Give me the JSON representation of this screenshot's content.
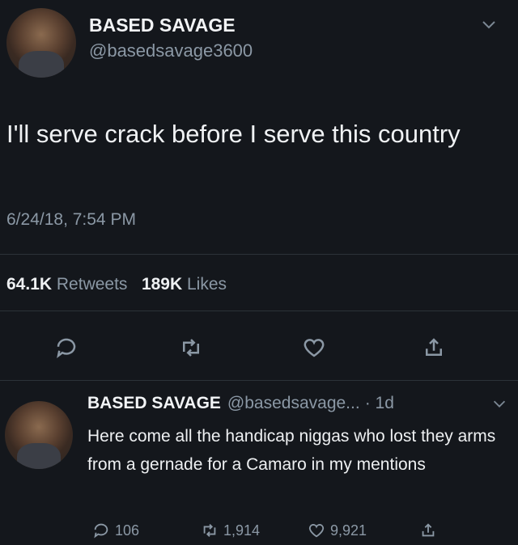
{
  "tweet": {
    "display_name": "BASED SAVAGE",
    "handle": "@basedsavage3600",
    "text": "I'll serve crack before I serve this country",
    "timestamp": "6/24/18, 7:54 PM",
    "retweets_count": "64.1K",
    "retweets_label": "Retweets",
    "likes_count": "189K",
    "likes_label": "Likes"
  },
  "reply": {
    "display_name": "BASED SAVAGE",
    "handle": "@basedsavage...",
    "time": "· 1d",
    "text": "Here come all the handicap niggas who lost they arms from a gernade for a Camaro in my mentions",
    "reply_count": "106",
    "retweet_count": "1,914",
    "like_count": "9,921"
  },
  "icons": [
    "chevron-down-icon",
    "reply-icon",
    "retweet-icon",
    "heart-icon",
    "share-icon"
  ],
  "colors": {
    "background": "#14171c",
    "text": "#e9ecef",
    "secondary": "#8b98a5",
    "divider": "#2c3238"
  }
}
